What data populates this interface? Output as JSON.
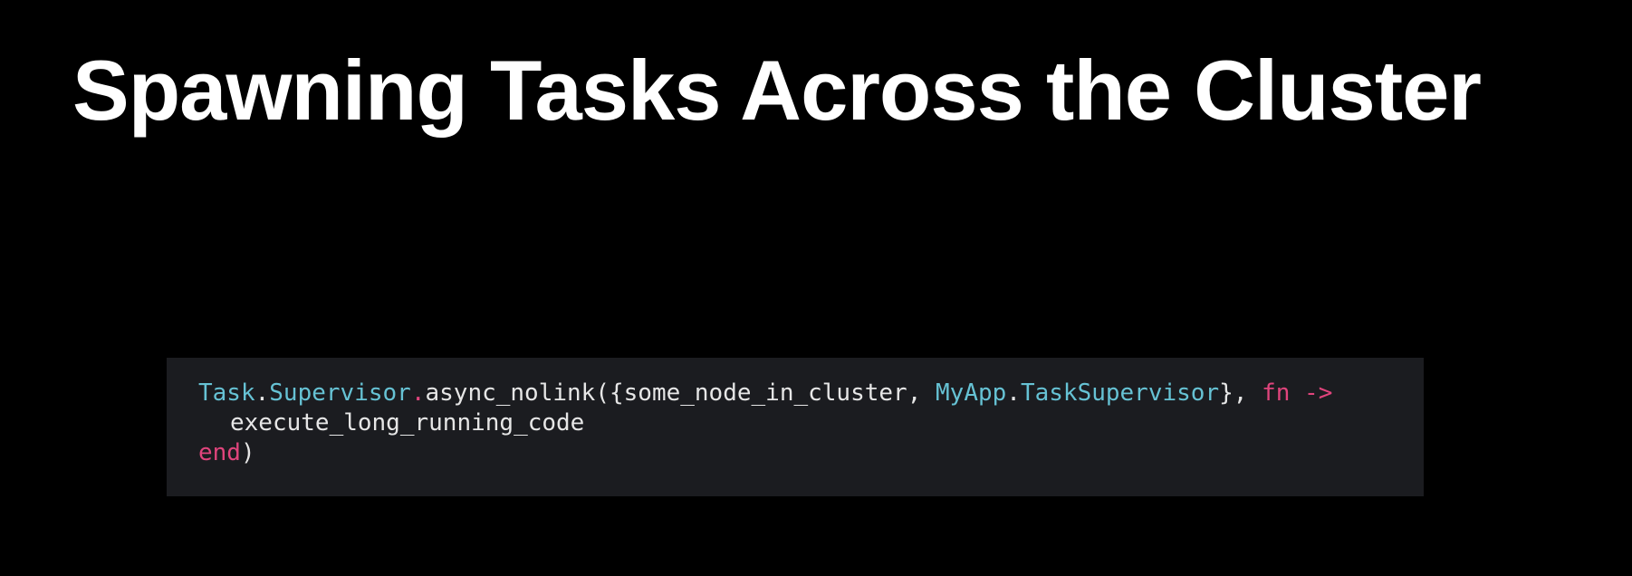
{
  "slide": {
    "title": "Spawning Tasks Across the Cluster"
  },
  "code": {
    "line1": {
      "mod1": "Task",
      "dot1": ".",
      "mod2": "Supervisor",
      "dot2": ".",
      "func": "async_nolink({some_node_in_cluster, ",
      "mod3": "MyApp",
      "dot3": ".",
      "mod4": "TaskSupervisor",
      "close": "}, ",
      "kw_fn": "fn",
      "space": " ",
      "arrow": "->"
    },
    "line2": {
      "body": "execute_long_running_code"
    },
    "line3": {
      "kw_end": "end",
      "close": ")"
    }
  },
  "colors": {
    "background": "#000000",
    "code_background": "#1b1c20",
    "module": "#66c2d4",
    "keyword": "#e0447c",
    "text": "#e6e6e6"
  }
}
